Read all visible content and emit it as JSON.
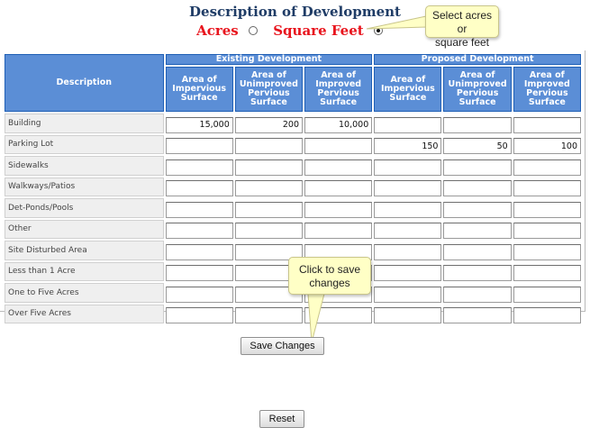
{
  "header": {
    "title": "Description of Development",
    "unit_options": [
      {
        "label": "Acres",
        "checked": false
      },
      {
        "label": "Square Feet",
        "checked": true
      }
    ]
  },
  "tooltips": {
    "units_hint": [
      "Select acres or",
      "square feet"
    ],
    "save_hint": [
      "Click to save",
      "changes"
    ]
  },
  "table": {
    "description_header": "Description",
    "groups": [
      "Existing Development",
      "Proposed Development"
    ],
    "subheaders": [
      [
        "Area of",
        "Impervious",
        "Surface"
      ],
      [
        "Area of",
        "Unimproved",
        "Pervious",
        "Surface"
      ],
      [
        "Area of",
        "Improved",
        "Pervious",
        "Surface"
      ],
      [
        "Area of",
        "Impervious",
        "Surface"
      ],
      [
        "Area of",
        "Unimproved",
        "Pervious",
        "Surface"
      ],
      [
        "Area of",
        "Improved",
        "Pervious",
        "Surface"
      ]
    ],
    "rows": [
      {
        "label": "Building",
        "values": [
          "15,000",
          "200",
          "10,000",
          "",
          "",
          ""
        ]
      },
      {
        "label": "Parking Lot",
        "values": [
          "",
          "",
          "",
          "150",
          "50",
          "100"
        ]
      },
      {
        "label": "Sidewalks",
        "values": [
          "",
          "",
          "",
          "",
          "",
          ""
        ]
      },
      {
        "label": "Walkways/Patios",
        "values": [
          "",
          "",
          "",
          "",
          "",
          ""
        ]
      },
      {
        "label": "Det-Ponds/Pools",
        "values": [
          "",
          "",
          "",
          "",
          "",
          ""
        ]
      },
      {
        "label": "Other",
        "values": [
          "",
          "",
          "",
          "",
          "",
          ""
        ]
      },
      {
        "label": "Site Disturbed Area",
        "values": [
          "",
          "",
          "",
          "",
          "",
          ""
        ]
      },
      {
        "label": "Less than 1 Acre",
        "values": [
          "",
          "",
          "",
          "",
          "",
          ""
        ]
      },
      {
        "label": "One to Five Acres",
        "values": [
          "",
          "",
          "",
          "",
          "",
          ""
        ]
      },
      {
        "label": "Over Five Acres",
        "values": [
          "",
          "",
          "",
          "",
          "",
          ""
        ]
      }
    ]
  },
  "buttons": {
    "save": "Save Changes",
    "reset": "Reset"
  },
  "colors": {
    "title": "#1f3c66",
    "units": "#e8141d",
    "header_bg": "#5b8ed6",
    "callout_bg": "#ffffc6"
  }
}
